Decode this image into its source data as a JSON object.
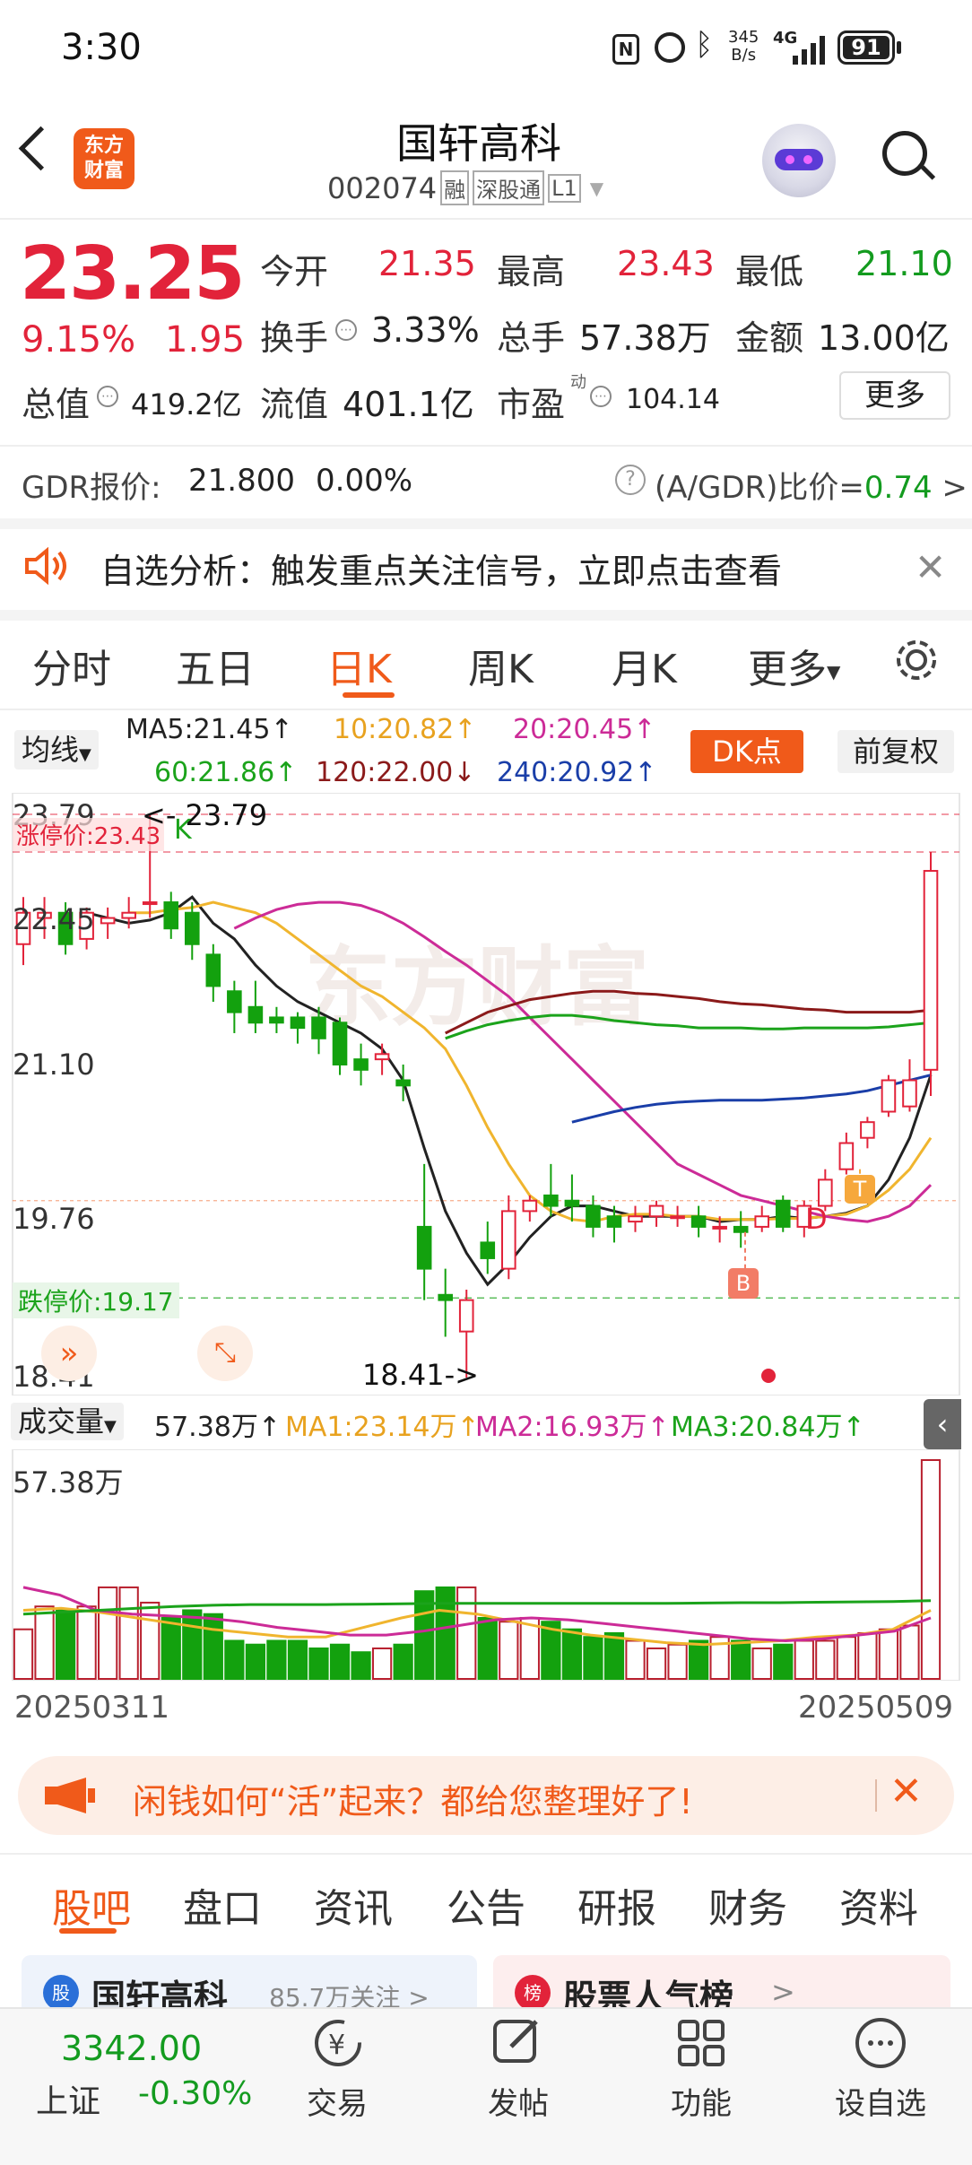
{
  "status": {
    "time": "3:30",
    "net_speed_top": "345",
    "net_speed_bottom": "B/s",
    "net_type": "4G",
    "battery": "91"
  },
  "header": {
    "logo_top": "东方",
    "logo_bottom": "财富",
    "name": "国轩高科",
    "code": "002074",
    "tags": [
      "融",
      "深股通",
      "L1"
    ]
  },
  "quote": {
    "price": "23.25",
    "pct": "9.15%",
    "change": "1.95",
    "open_label": "今开",
    "open": "21.35",
    "high_label": "最高",
    "high": "23.43",
    "low_label": "最低",
    "low": "21.10",
    "turnover_label": "换手",
    "turnover": "3.33%",
    "volume_label": "总手",
    "volume": "57.38万",
    "amount_label": "金额",
    "amount": "13.00亿",
    "mcap_label": "总值",
    "mcap": "419.2亿",
    "float_label": "流值",
    "float": "401.1亿",
    "pe_label": "市盈",
    "pe_sup": "动",
    "pe": "104.14",
    "more": "更多"
  },
  "gdr": {
    "label": "GDR报价:",
    "price": "21.800",
    "pct": "0.00%",
    "ratio_label": "(A/GDR)比价=",
    "ratio": "0.74",
    "arrow": ">"
  },
  "notice": {
    "text": "自选分析：触发重点关注信号，立即点击查看"
  },
  "chart_tabs": [
    "分时",
    "五日",
    "日K",
    "周K",
    "月K",
    "更多"
  ],
  "chart_tab_active": 2,
  "ma_bar": {
    "type_label": "均线",
    "ma5": "MA5:21.45↑",
    "ma10": "10:20.82↑",
    "ma20": "20:20.45↑",
    "ma60": "60:21.86↑",
    "ma120": "120:22.00↓",
    "ma240": "240:20.92↑",
    "dk_button": "DK点",
    "fq_button": "前复权"
  },
  "kline": {
    "y_labels": [
      "23.79",
      "22.45",
      "21.10",
      "19.76",
      "18.41"
    ],
    "limit_up_label": "涨停价:23.43",
    "limit_down_label": "跌停价:19.17",
    "max_marker": "<- 23.79",
    "min_marker": "18.41->",
    "k_marker": "K",
    "signal_b": "B",
    "signal_d": "D",
    "signal_t": "T"
  },
  "volume": {
    "type_label": "成交量",
    "value": "57.38万↑",
    "ma1": "MA1:23.14万↑",
    "ma2": "MA2:16.93万↑",
    "ma3": "MA3:20.84万↑",
    "y_label": "57.38万",
    "date_start": "20250311",
    "date_end": "20250509"
  },
  "chart_data": {
    "type": "candlestick",
    "ylim": [
      18.41,
      23.79
    ],
    "candles": [
      {
        "o": 22.55,
        "c": 22.85,
        "h": 23.0,
        "l": 22.35
      },
      {
        "o": 22.8,
        "c": 22.85,
        "h": 23.0,
        "l": 22.6
      },
      {
        "o": 22.85,
        "c": 22.55,
        "h": 22.95,
        "l": 22.45
      },
      {
        "o": 22.6,
        "c": 22.85,
        "h": 22.9,
        "l": 22.5
      },
      {
        "o": 22.75,
        "c": 22.8,
        "h": 22.9,
        "l": 22.6
      },
      {
        "o": 22.8,
        "c": 22.85,
        "h": 23.0,
        "l": 22.7
      },
      {
        "o": 22.95,
        "c": 22.95,
        "h": 23.79,
        "l": 22.8
      },
      {
        "o": 22.95,
        "c": 22.7,
        "h": 23.05,
        "l": 22.6
      },
      {
        "o": 22.85,
        "c": 22.55,
        "h": 22.95,
        "l": 22.4
      },
      {
        "o": 22.45,
        "c": 22.15,
        "h": 22.55,
        "l": 22.0
      },
      {
        "o": 22.1,
        "c": 21.9,
        "h": 22.2,
        "l": 21.7
      },
      {
        "o": 21.95,
        "c": 21.8,
        "h": 22.2,
        "l": 21.7
      },
      {
        "o": 21.85,
        "c": 21.8,
        "h": 21.95,
        "l": 21.7
      },
      {
        "o": 21.85,
        "c": 21.75,
        "h": 21.9,
        "l": 21.6
      },
      {
        "o": 21.85,
        "c": 21.65,
        "h": 21.95,
        "l": 21.5
      },
      {
        "o": 21.8,
        "c": 21.4,
        "h": 21.85,
        "l": 21.3
      },
      {
        "o": 21.45,
        "c": 21.35,
        "h": 21.6,
        "l": 21.2
      },
      {
        "o": 21.45,
        "c": 21.5,
        "h": 21.6,
        "l": 21.3
      },
      {
        "o": 21.25,
        "c": 21.2,
        "h": 21.4,
        "l": 21.05
      },
      {
        "o": 19.85,
        "c": 19.45,
        "h": 20.45,
        "l": 19.15
      },
      {
        "o": 19.2,
        "c": 19.15,
        "h": 19.45,
        "l": 18.8
      },
      {
        "o": 18.85,
        "c": 19.15,
        "h": 19.25,
        "l": 18.41
      },
      {
        "o": 19.7,
        "c": 19.55,
        "h": 19.9,
        "l": 19.4
      },
      {
        "o": 19.45,
        "c": 20.0,
        "h": 20.15,
        "l": 19.35
      },
      {
        "o": 20.0,
        "c": 20.1,
        "h": 20.15,
        "l": 19.9
      },
      {
        "o": 20.15,
        "c": 20.05,
        "h": 20.45,
        "l": 19.95
      },
      {
        "o": 20.1,
        "c": 20.05,
        "h": 20.35,
        "l": 19.9
      },
      {
        "o": 20.05,
        "c": 19.85,
        "h": 20.15,
        "l": 19.75
      },
      {
        "o": 19.95,
        "c": 19.85,
        "h": 20.05,
        "l": 19.7
      },
      {
        "o": 19.9,
        "c": 19.95,
        "h": 20.05,
        "l": 19.8
      },
      {
        "o": 19.95,
        "c": 20.05,
        "h": 20.1,
        "l": 19.85
      },
      {
        "o": 19.95,
        "c": 19.95,
        "h": 20.05,
        "l": 19.85
      },
      {
        "o": 19.95,
        "c": 19.85,
        "h": 20.05,
        "l": 19.75
      },
      {
        "o": 19.85,
        "c": 19.85,
        "h": 19.95,
        "l": 19.7
      },
      {
        "o": 19.85,
        "c": 19.8,
        "h": 20.0,
        "l": 19.65
      },
      {
        "o": 19.85,
        "c": 19.95,
        "h": 20.05,
        "l": 19.8
      },
      {
        "o": 20.1,
        "c": 19.85,
        "h": 20.15,
        "l": 19.8
      },
      {
        "o": 19.85,
        "c": 20.05,
        "h": 20.1,
        "l": 19.75
      },
      {
        "o": 20.05,
        "c": 20.3,
        "h": 20.4,
        "l": 20.0
      },
      {
        "o": 20.4,
        "c": 20.65,
        "h": 20.75,
        "l": 20.35
      },
      {
        "o": 20.7,
        "c": 20.85,
        "h": 20.9,
        "l": 20.6
      },
      {
        "o": 20.95,
        "c": 21.25,
        "h": 21.3,
        "l": 20.9
      },
      {
        "o": 21.0,
        "c": 21.25,
        "h": 21.45,
        "l": 20.95
      },
      {
        "o": 21.35,
        "c": 23.25,
        "h": 23.43,
        "l": 21.1
      }
    ],
    "ma_series": [
      {
        "name": "MA5",
        "color": "#222222",
        "values": [
          22.85,
          22.8,
          22.75,
          22.78,
          22.85,
          23.0,
          22.75,
          22.6,
          22.35,
          22.15,
          22.0,
          21.9,
          21.8,
          21.7,
          21.55,
          21.25,
          20.6,
          20.0,
          19.6,
          19.3,
          19.5,
          19.75,
          19.95,
          20.05,
          20.05,
          20.0,
          19.95,
          19.95,
          19.95,
          19.95,
          19.9,
          19.92,
          19.92,
          19.95,
          19.93,
          19.95,
          19.98,
          20.05,
          20.3,
          20.7,
          21.3
        ]
      },
      {
        "name": "MA10",
        "color": "#f0b52e",
        "values": [
          22.85,
          22.85,
          22.88,
          22.9,
          22.95,
          22.9,
          22.85,
          22.75,
          22.6,
          22.45,
          22.3,
          22.15,
          22.05,
          21.9,
          21.75,
          21.55,
          21.2,
          20.8,
          20.45,
          20.15,
          20.0,
          19.92,
          19.9,
          19.95,
          19.97,
          19.97,
          19.95,
          19.95,
          19.92,
          19.92,
          19.92,
          19.93,
          19.93,
          19.95,
          19.97,
          20.05,
          20.2,
          20.4,
          20.7
        ]
      },
      {
        "name": "MA20",
        "color": "#cc2b97",
        "values": [
          22.7,
          22.8,
          22.88,
          22.93,
          22.95,
          22.95,
          22.92,
          22.85,
          22.75,
          22.62,
          22.48,
          22.35,
          22.2,
          22.05,
          21.85,
          21.65,
          21.45,
          21.25,
          21.05,
          20.85,
          20.65,
          20.45,
          20.35,
          20.25,
          20.15,
          20.1,
          20.05,
          20.0,
          19.95,
          19.92,
          19.9,
          19.95,
          20.05,
          20.25
        ]
      },
      {
        "name": "MA60",
        "color": "#1ba31b",
        "values": [
          21.65,
          21.72,
          21.78,
          21.82,
          21.85,
          21.87,
          21.87,
          21.85,
          21.82,
          21.8,
          21.78,
          21.77,
          21.75,
          21.75,
          21.75,
          21.74,
          21.74,
          21.75,
          21.75,
          21.75,
          21.75,
          21.76,
          21.78,
          21.8
        ]
      },
      {
        "name": "MA120",
        "color": "#8b1a1a",
        "values": [
          21.7,
          21.8,
          21.9,
          21.96,
          22.02,
          22.05,
          22.08,
          22.1,
          22.1,
          22.08,
          22.07,
          22.05,
          22.03,
          22.0,
          21.98,
          21.97,
          21.95,
          21.93,
          21.92,
          21.9,
          21.9,
          21.9,
          21.9,
          21.92
        ]
      },
      {
        "name": "MA240",
        "color": "#1a3ea8",
        "values": [
          20.85,
          20.9,
          20.95,
          20.99,
          21.02,
          21.04,
          21.05,
          21.06,
          21.06,
          21.06,
          21.07,
          21.08,
          21.1,
          21.12,
          21.15,
          21.2,
          21.25,
          21.3
        ]
      }
    ],
    "volume_ylim": [
      0,
      57.38
    ],
    "volumes": [
      13,
      19,
      18,
      19,
      24,
      24,
      20,
      16,
      18,
      17,
      10,
      9,
      10,
      10,
      8,
      9,
      7,
      8,
      9,
      23,
      24,
      24,
      16,
      15,
      16,
      15,
      13,
      11,
      12,
      10,
      8,
      9,
      10,
      11,
      10,
      8,
      9,
      10,
      10,
      11,
      12,
      13,
      14,
      57.38
    ],
    "volume_ma": [
      {
        "name": "MA1",
        "color": "#f0b52e",
        "values": [
          18,
          18.5,
          17.5,
          16,
          14.5,
          13,
          12,
          11,
          11,
          13.5,
          16,
          18,
          17,
          15,
          13,
          11.5,
          10.5,
          9.5,
          9,
          9.5,
          10,
          11,
          11.5,
          13,
          18
        ]
      },
      {
        "name": "MA2",
        "color": "#cc2b97",
        "values": [
          24,
          22,
          18,
          17,
          16.5,
          16,
          15,
          13.5,
          12.5,
          11.5,
          11.5,
          12.5,
          14,
          15.5,
          16,
          15.5,
          14.5,
          13.5,
          12.5,
          11.5,
          10.5,
          10,
          10.5,
          11.5,
          12.5,
          16
        ]
      },
      {
        "name": "MA3",
        "color": "#1ba31b",
        "values": [
          17,
          17.5,
          18,
          18.5,
          19,
          19.3,
          19.5,
          19.5,
          19.5,
          19.6,
          19.7,
          19.8,
          19.8,
          19.8,
          19.8,
          19.8,
          19.8,
          19.8,
          19.9,
          20,
          20,
          20.1,
          20.2,
          20.3,
          20.5
        ]
      }
    ]
  },
  "ad_banner": {
    "text": "闲钱如何“活”起来？都给您整理好了!"
  },
  "sub_tabs": [
    "股吧",
    "盘口",
    "资讯",
    "公告",
    "研报",
    "财务",
    "资料"
  ],
  "sub_tab_active": 0,
  "cards": [
    {
      "title": "国轩高科",
      "sub": "85.7万关注 >"
    },
    {
      "title": "股票人气榜",
      "sub": ">"
    }
  ],
  "bottom": {
    "index_value": "3342.00",
    "index_name": "上证",
    "index_pct": "-0.30%",
    "items": [
      "交易",
      "发帖",
      "功能",
      "设自选"
    ]
  }
}
